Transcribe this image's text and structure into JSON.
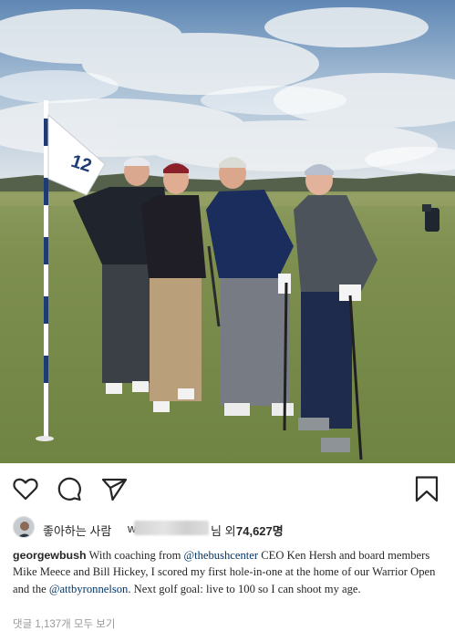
{
  "post": {
    "actions": [
      {
        "icon": "heart-outline-icon",
        "label": "like"
      },
      {
        "icon": "comment-bubble-icon",
        "label": "comment"
      },
      {
        "icon": "paper-plane-share-icon",
        "label": "share"
      },
      {
        "icon": "bookmark-outline-icon",
        "label": "save"
      }
    ],
    "flag_number": "12",
    "likes": {
      "prefix": "좋아하는 사람",
      "partial_name": "w",
      "suffix": "님 외",
      "count": "74,627명"
    },
    "caption": {
      "username": "georgewbush",
      "text_1": " With coaching from ",
      "mention_1": "@thebushcenter",
      "text_2": " CEO Ken Hersh and board members Mike Meece and Bill Hickey, I scored my first hole-in-one at the home of our Warrior Open and the ",
      "mention_2": "@attbyronnelson",
      "text_3": ". Next golf goal: live to 100 so I can shoot my age."
    },
    "comments_link": "댓글 1,137개 모두 보기"
  },
  "colors": {
    "text": "#262626",
    "mention": "#003569",
    "muted": "#999999",
    "fairway": "#7e8f4f",
    "sky": "#a9c4dc"
  }
}
